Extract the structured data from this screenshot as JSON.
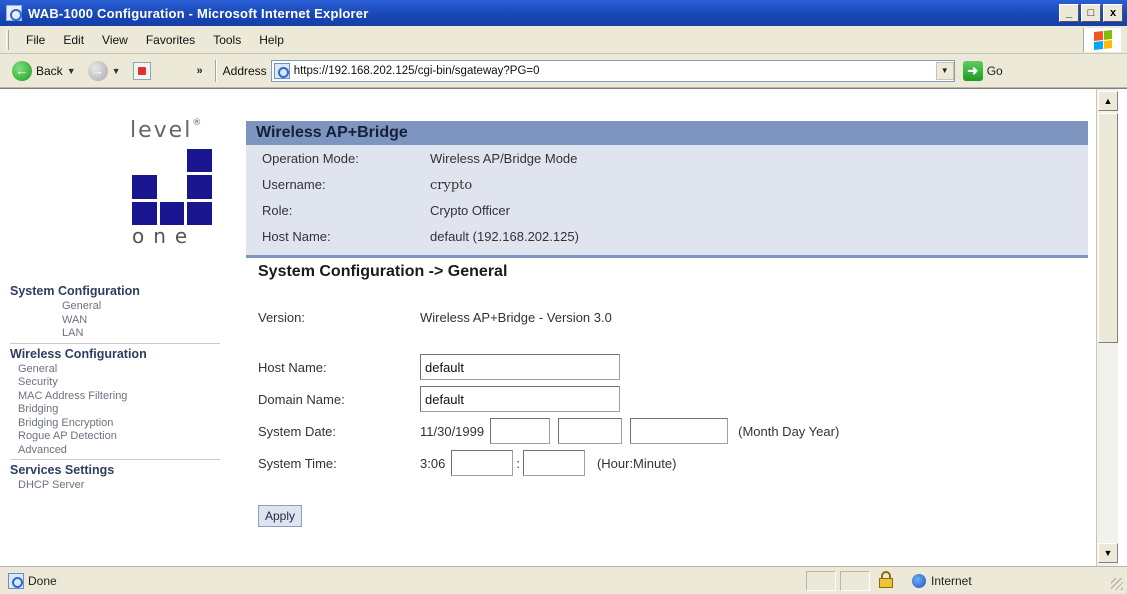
{
  "window": {
    "title": "WAB-1000 Configuration - Microsoft Internet Explorer",
    "minimize": "_",
    "maximize": "□",
    "close": "x"
  },
  "menu": [
    "File",
    "Edit",
    "View",
    "Favorites",
    "Tools",
    "Help"
  ],
  "toolbar": {
    "back_label": "Back",
    "chevron": "»",
    "address_label": "Address",
    "url": "https://192.168.202.125/cgi-bin/sgateway?PG=0",
    "go_label": "Go"
  },
  "logo": {
    "top": "level",
    "bottom": "one"
  },
  "sidebar": {
    "sections": [
      {
        "title": "System Configuration",
        "items": [
          "General",
          "WAN",
          "LAN"
        ]
      },
      {
        "title": "Wireless Configuration",
        "items": [
          "General",
          "Security",
          "MAC Address Filtering",
          "Bridging",
          "Bridging Encryption",
          "Rogue AP Detection",
          "Advanced"
        ]
      },
      {
        "title": "Services Settings",
        "items": [
          "DHCP Server"
        ]
      }
    ]
  },
  "header": {
    "title": "Wireless AP+Bridge",
    "info": [
      {
        "label": "Operation Mode:",
        "value": "Wireless AP/Bridge Mode"
      },
      {
        "label": "Username:",
        "value": "crypto"
      },
      {
        "label": "Role:",
        "value": "Crypto Officer"
      },
      {
        "label": "Host Name:",
        "value": "default (192.168.202.125)"
      }
    ]
  },
  "form": {
    "section_title": "System Configuration -> General",
    "version_label": "Version:",
    "version_value": "Wireless AP+Bridge - Version 3.0",
    "host_label": "Host Name:",
    "host_value": "default",
    "domain_label": "Domain Name:",
    "domain_value": "default",
    "date_label": "System Date:",
    "date_value": "11/30/1999",
    "date_hint": "(Month Day Year)",
    "time_label": "System Time:",
    "time_value": "3:06",
    "time_sep": ":",
    "time_hint": "(Hour:Minute)",
    "apply_label": "Apply"
  },
  "status": {
    "text": "Done",
    "zone": "Internet"
  },
  "colors": {
    "accent_bar": "#7e95bf",
    "info_bg": "#dfe4ef",
    "logo_blue": "#1a1690"
  }
}
